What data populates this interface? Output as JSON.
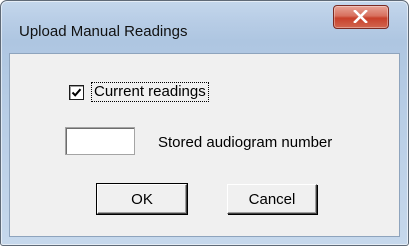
{
  "window": {
    "title": "Upload Manual Readings",
    "close_icon": "close-icon"
  },
  "dialog": {
    "current_readings": {
      "label": "Current readings",
      "checked": true
    },
    "stored_audiogram": {
      "label": "Stored audiogram number",
      "value": ""
    },
    "ok_label": "OK",
    "cancel_label": "Cancel"
  },
  "colors": {
    "close_button": "#c7402b",
    "client_background": "#f0f0f0"
  }
}
